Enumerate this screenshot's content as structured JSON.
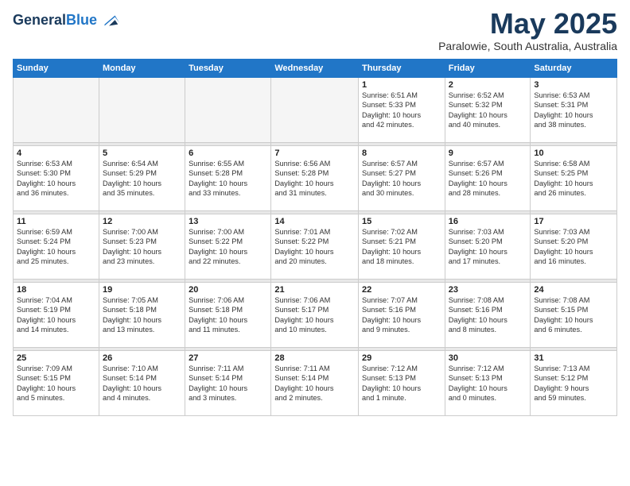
{
  "logo": {
    "general": "General",
    "blue": "Blue"
  },
  "title": "May 2025",
  "subtitle": "Paralowie, South Australia, Australia",
  "days_of_week": [
    "Sunday",
    "Monday",
    "Tuesday",
    "Wednesday",
    "Thursday",
    "Friday",
    "Saturday"
  ],
  "weeks": [
    [
      {
        "day": "",
        "info": ""
      },
      {
        "day": "",
        "info": ""
      },
      {
        "day": "",
        "info": ""
      },
      {
        "day": "",
        "info": ""
      },
      {
        "day": "1",
        "info": "Sunrise: 6:51 AM\nSunset: 5:33 PM\nDaylight: 10 hours\nand 42 minutes."
      },
      {
        "day": "2",
        "info": "Sunrise: 6:52 AM\nSunset: 5:32 PM\nDaylight: 10 hours\nand 40 minutes."
      },
      {
        "day": "3",
        "info": "Sunrise: 6:53 AM\nSunset: 5:31 PM\nDaylight: 10 hours\nand 38 minutes."
      }
    ],
    [
      {
        "day": "4",
        "info": "Sunrise: 6:53 AM\nSunset: 5:30 PM\nDaylight: 10 hours\nand 36 minutes."
      },
      {
        "day": "5",
        "info": "Sunrise: 6:54 AM\nSunset: 5:29 PM\nDaylight: 10 hours\nand 35 minutes."
      },
      {
        "day": "6",
        "info": "Sunrise: 6:55 AM\nSunset: 5:28 PM\nDaylight: 10 hours\nand 33 minutes."
      },
      {
        "day": "7",
        "info": "Sunrise: 6:56 AM\nSunset: 5:28 PM\nDaylight: 10 hours\nand 31 minutes."
      },
      {
        "day": "8",
        "info": "Sunrise: 6:57 AM\nSunset: 5:27 PM\nDaylight: 10 hours\nand 30 minutes."
      },
      {
        "day": "9",
        "info": "Sunrise: 6:57 AM\nSunset: 5:26 PM\nDaylight: 10 hours\nand 28 minutes."
      },
      {
        "day": "10",
        "info": "Sunrise: 6:58 AM\nSunset: 5:25 PM\nDaylight: 10 hours\nand 26 minutes."
      }
    ],
    [
      {
        "day": "11",
        "info": "Sunrise: 6:59 AM\nSunset: 5:24 PM\nDaylight: 10 hours\nand 25 minutes."
      },
      {
        "day": "12",
        "info": "Sunrise: 7:00 AM\nSunset: 5:23 PM\nDaylight: 10 hours\nand 23 minutes."
      },
      {
        "day": "13",
        "info": "Sunrise: 7:00 AM\nSunset: 5:22 PM\nDaylight: 10 hours\nand 22 minutes."
      },
      {
        "day": "14",
        "info": "Sunrise: 7:01 AM\nSunset: 5:22 PM\nDaylight: 10 hours\nand 20 minutes."
      },
      {
        "day": "15",
        "info": "Sunrise: 7:02 AM\nSunset: 5:21 PM\nDaylight: 10 hours\nand 18 minutes."
      },
      {
        "day": "16",
        "info": "Sunrise: 7:03 AM\nSunset: 5:20 PM\nDaylight: 10 hours\nand 17 minutes."
      },
      {
        "day": "17",
        "info": "Sunrise: 7:03 AM\nSunset: 5:20 PM\nDaylight: 10 hours\nand 16 minutes."
      }
    ],
    [
      {
        "day": "18",
        "info": "Sunrise: 7:04 AM\nSunset: 5:19 PM\nDaylight: 10 hours\nand 14 minutes."
      },
      {
        "day": "19",
        "info": "Sunrise: 7:05 AM\nSunset: 5:18 PM\nDaylight: 10 hours\nand 13 minutes."
      },
      {
        "day": "20",
        "info": "Sunrise: 7:06 AM\nSunset: 5:18 PM\nDaylight: 10 hours\nand 11 minutes."
      },
      {
        "day": "21",
        "info": "Sunrise: 7:06 AM\nSunset: 5:17 PM\nDaylight: 10 hours\nand 10 minutes."
      },
      {
        "day": "22",
        "info": "Sunrise: 7:07 AM\nSunset: 5:16 PM\nDaylight: 10 hours\nand 9 minutes."
      },
      {
        "day": "23",
        "info": "Sunrise: 7:08 AM\nSunset: 5:16 PM\nDaylight: 10 hours\nand 8 minutes."
      },
      {
        "day": "24",
        "info": "Sunrise: 7:08 AM\nSunset: 5:15 PM\nDaylight: 10 hours\nand 6 minutes."
      }
    ],
    [
      {
        "day": "25",
        "info": "Sunrise: 7:09 AM\nSunset: 5:15 PM\nDaylight: 10 hours\nand 5 minutes."
      },
      {
        "day": "26",
        "info": "Sunrise: 7:10 AM\nSunset: 5:14 PM\nDaylight: 10 hours\nand 4 minutes."
      },
      {
        "day": "27",
        "info": "Sunrise: 7:11 AM\nSunset: 5:14 PM\nDaylight: 10 hours\nand 3 minutes."
      },
      {
        "day": "28",
        "info": "Sunrise: 7:11 AM\nSunset: 5:14 PM\nDaylight: 10 hours\nand 2 minutes."
      },
      {
        "day": "29",
        "info": "Sunrise: 7:12 AM\nSunset: 5:13 PM\nDaylight: 10 hours\nand 1 minute."
      },
      {
        "day": "30",
        "info": "Sunrise: 7:12 AM\nSunset: 5:13 PM\nDaylight: 10 hours\nand 0 minutes."
      },
      {
        "day": "31",
        "info": "Sunrise: 7:13 AM\nSunset: 5:12 PM\nDaylight: 9 hours\nand 59 minutes."
      }
    ]
  ]
}
